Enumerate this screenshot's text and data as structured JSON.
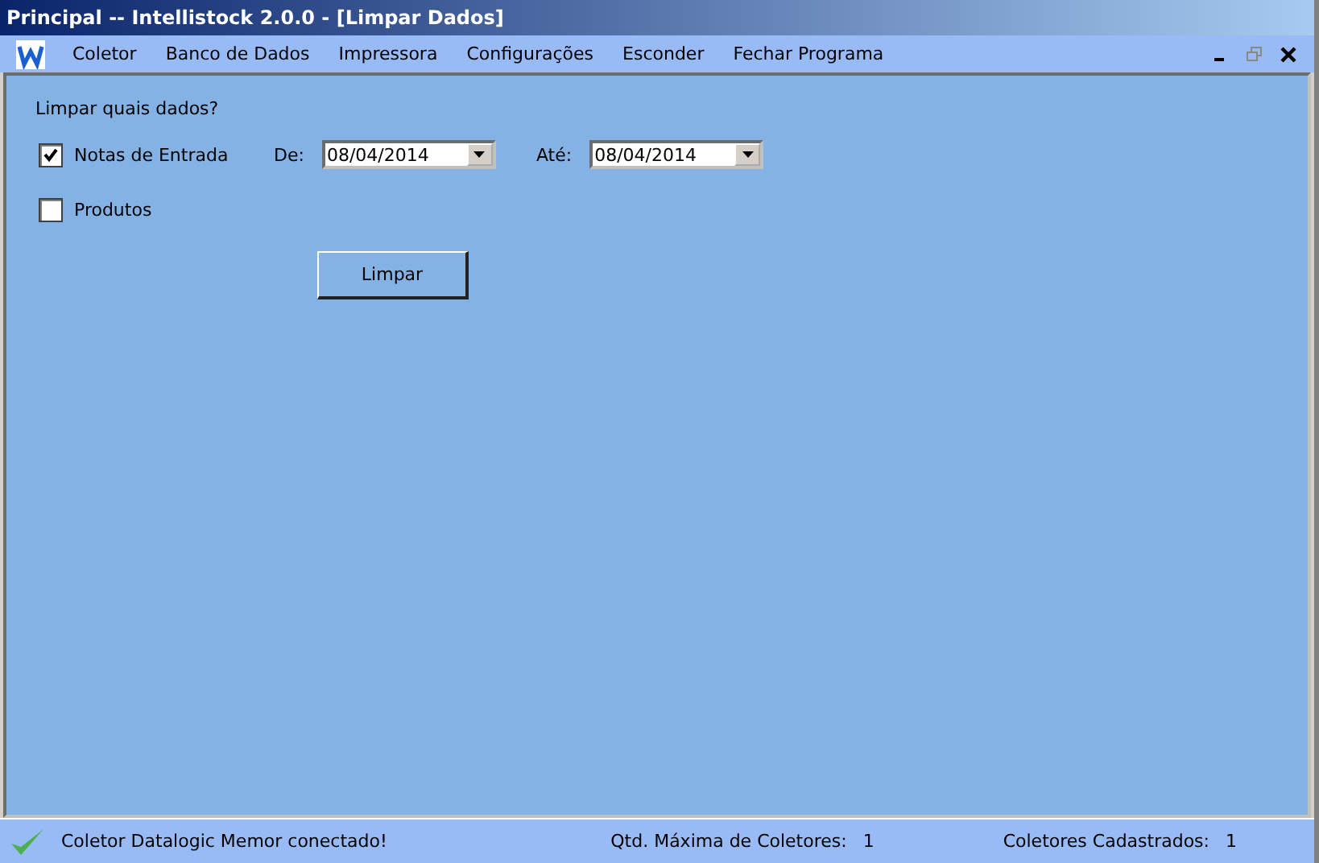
{
  "window": {
    "title": "Principal -- Intellistock 2.0.0 - [Limpar Dados]"
  },
  "menu": [
    "Coletor",
    "Banco de Dados",
    "Impressora",
    "Configurações",
    "Esconder",
    "Fechar Programa"
  ],
  "form": {
    "heading": "Limpar quais dados?",
    "options": [
      {
        "label": "Notas de Entrada",
        "checked": true
      },
      {
        "label": "Produtos",
        "checked": false
      }
    ],
    "from_label": "De:",
    "from_value": "08/04/2014",
    "to_label": "Até:",
    "to_value": "08/04/2014",
    "button": "Limpar"
  },
  "status_bar": {
    "message": "Coletor Datalogic Memor conectado!",
    "max_label": "Qtd. Máxima de Coletores:",
    "max_value": "1",
    "registered_label": "Coletores Cadastrados:",
    "registered_value": "1"
  }
}
